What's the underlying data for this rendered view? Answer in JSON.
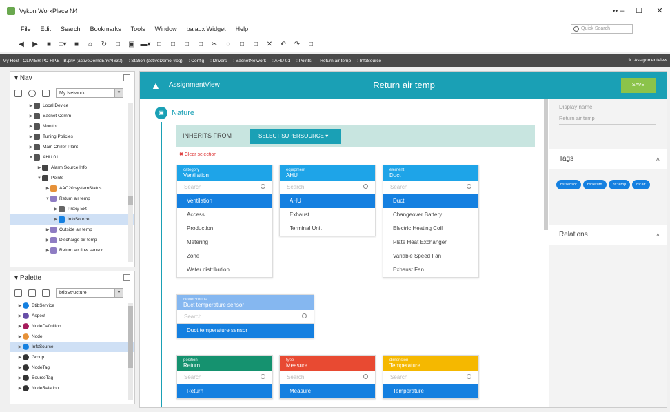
{
  "window": {
    "title": "Vykon WorkPlace N4",
    "controls": [
      "•• –",
      "☐",
      "✕"
    ]
  },
  "menu": [
    "File",
    "Edit",
    "Search",
    "Bookmarks",
    "Tools",
    "Window",
    "bajaux Widget",
    "Help"
  ],
  "quick_search": {
    "placeholder": "Quick Search"
  },
  "toolbar": [
    "◀",
    "▶",
    "■",
    "□▾",
    "■",
    "⌂",
    "↻",
    "□",
    "▣",
    "▬▾",
    "□",
    "□",
    "□",
    "□",
    "✂",
    "○",
    "□",
    "□",
    "✕",
    "↶",
    "↷",
    "□"
  ],
  "breadcrumb": [
    "My Host : OLIVIER-PC-HP.BTIB.priv (activeDemoEnvAI630)",
    ": Station (activeDemoProg)",
    ": Config",
    ": Drivers",
    ": BacnetNetwork",
    ": AHU 01",
    ": Points",
    ": Return air temp",
    ": InfoSource"
  ],
  "view_label": "AssignmentView",
  "nav": {
    "title": "Nav",
    "network": "My Network",
    "tree": [
      {
        "t": "Local Device",
        "d": 1,
        "tog": "▶",
        "c": "#555"
      },
      {
        "t": "Bacnet Comm",
        "d": 1,
        "tog": "▶",
        "c": "#555"
      },
      {
        "t": "Monitor",
        "d": 1,
        "tog": "▶",
        "c": "#555"
      },
      {
        "t": "Tuning Policies",
        "d": 1,
        "tog": "▶",
        "c": "#555"
      },
      {
        "t": "Main Chiller Plant",
        "d": 1,
        "tog": "▶",
        "c": "#555"
      },
      {
        "t": "AHU 01",
        "d": 1,
        "tog": "▼",
        "c": "#555"
      },
      {
        "t": "Alarm Source Info",
        "d": 2,
        "tog": "▶",
        "c": "#444"
      },
      {
        "t": "Points",
        "d": 2,
        "tog": "▼",
        "c": "#444"
      },
      {
        "t": "AAC20 systemStatus",
        "d": 3,
        "tog": "▶",
        "c": "#e69138"
      },
      {
        "t": "Return air temp",
        "d": 3,
        "tog": "▼",
        "c": "#8e7cc3"
      },
      {
        "t": "Proxy Ext",
        "d": 4,
        "tog": "▶",
        "c": "#666"
      },
      {
        "t": "InfoSource",
        "d": 4,
        "tog": "▶",
        "c": "#1580e0",
        "sel": true
      },
      {
        "t": "Outside air temp",
        "d": 3,
        "tog": "▶",
        "c": "#8e7cc3"
      },
      {
        "t": "Discharge air temp",
        "d": 3,
        "tog": "▶",
        "c": "#8e7cc3"
      },
      {
        "t": "Return air flow sensor",
        "d": 3,
        "tog": "▶",
        "c": "#8e7cc3"
      }
    ]
  },
  "palette": {
    "title": "Palette",
    "module": "btibStructure",
    "items": [
      {
        "t": "BtibService",
        "c": "#1580e0"
      },
      {
        "t": "Aspect",
        "c": "#674ea7"
      },
      {
        "t": "NodeDefinition",
        "c": "#a61c5c"
      },
      {
        "t": "Node",
        "c": "#e69138"
      },
      {
        "t": "InfoSource",
        "c": "#1580e0",
        "sel": true
      },
      {
        "t": "Group",
        "c": "#333"
      },
      {
        "t": "NodeTag",
        "c": "#333"
      },
      {
        "t": "SourceTag",
        "c": "#333"
      },
      {
        "t": "NodeRelation",
        "c": "#333"
      }
    ]
  },
  "assignment": {
    "header_name": "AssignmentView",
    "title": "Return air temp",
    "save": "SAVE",
    "section": "Nature",
    "inherits_label": "INHERITS FROM",
    "select_label": "SELECT SUPERSOURCE ▾",
    "clear": "✖ Clear selection",
    "search_placeholder": "Search"
  },
  "tag_cards": [
    {
      "key": "category",
      "value": "Ventilation",
      "color": "#1ea4e8",
      "options": [
        "Ventilation",
        "Access",
        "Production",
        "Metering",
        "Zone",
        "Water distribution"
      ],
      "selected": 0
    },
    {
      "key": "equipment",
      "value": "AHU",
      "color": "#1ea4e8",
      "options": [
        "AHU",
        "Exhaust",
        "Terminal Unit"
      ],
      "selected": 0
    },
    {
      "key": "element",
      "value": "Duct",
      "color": "#1ea4e8",
      "options": [
        "Duct",
        "Changeover Battery",
        "Electric Heating Coil",
        "Plate Heat Exchanger",
        "Variable Speed Fan",
        "Exhaust Fan"
      ],
      "selected": 0
    },
    {
      "key": "NodeGroups",
      "value": "Duct temperature sensor",
      "color": "#85b7f0",
      "options": [
        "Duct temperature sensor"
      ],
      "selected": 0
    },
    {
      "key": "position",
      "value": "Return",
      "color": "#15926f",
      "options": [
        "Return"
      ],
      "selected": 0
    },
    {
      "key": "type",
      "value": "Measure",
      "color": "#e84a32",
      "options": [
        "Measure"
      ],
      "selected": 0
    },
    {
      "key": "dimension",
      "value": "Temperature",
      "color": "#f5b800",
      "options": [
        "Temperature"
      ],
      "selected": 0
    }
  ],
  "right_panel": {
    "display_name_label": "Display name",
    "display_name_value": "Return air temp",
    "tags_title": "Tags",
    "tags": [
      "hs:sensor",
      "hs:return",
      "hs:temp",
      "hs:air"
    ],
    "relations_title": "Relations",
    "caret": "˄"
  }
}
